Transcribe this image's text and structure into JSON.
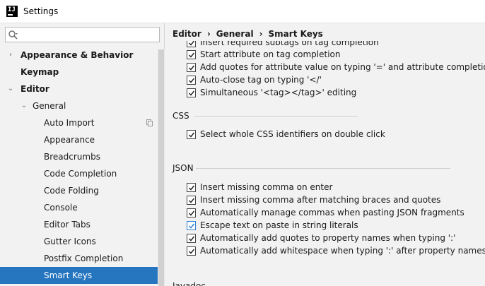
{
  "window": {
    "title": "Settings"
  },
  "search": {
    "placeholder": "",
    "value": ""
  },
  "sidebar": {
    "items": [
      {
        "label": "Appearance & Behavior"
      },
      {
        "label": "Keymap"
      },
      {
        "label": "Editor"
      },
      {
        "label": "General"
      },
      {
        "label": "Auto Import"
      },
      {
        "label": "Appearance"
      },
      {
        "label": "Breadcrumbs"
      },
      {
        "label": "Code Completion"
      },
      {
        "label": "Code Folding"
      },
      {
        "label": "Console"
      },
      {
        "label": "Editor Tabs"
      },
      {
        "label": "Gutter Icons"
      },
      {
        "label": "Postfix Completion"
      },
      {
        "label": "Smart Keys"
      }
    ],
    "selected": "Smart Keys"
  },
  "breadcrumb": {
    "part1": "Editor",
    "part2": "General",
    "part3": "Smart Keys",
    "separator": "›"
  },
  "options": {
    "xml": [
      {
        "label": "Insert required subtags on tag completion",
        "checked": true
      },
      {
        "label": "Start attribute on tag completion",
        "checked": true
      },
      {
        "label": "Add quotes for attribute value on typing '=' and attribute completion",
        "checked": true
      },
      {
        "label": "Auto-close tag on typing '</'",
        "checked": true
      },
      {
        "label": "Simultaneous '<tag></tag>' editing",
        "checked": true
      }
    ],
    "css_title": "CSS",
    "css": [
      {
        "label": "Select whole CSS identifiers on double click",
        "checked": true
      }
    ],
    "json_title": "JSON",
    "json": [
      {
        "label": "Insert missing comma on enter",
        "checked": true
      },
      {
        "label": "Insert missing comma after matching braces and quotes",
        "checked": true
      },
      {
        "label": "Automatically manage commas when pasting JSON fragments",
        "checked": true
      },
      {
        "label": "Escape text on paste in string literals",
        "checked": true
      },
      {
        "label": "Automatically add quotes to property names when typing ':'",
        "checked": true
      },
      {
        "label": "Automatically add whitespace when typing ':' after property namess",
        "checked": true
      }
    ],
    "javadoc_title": "Javadoc"
  },
  "colors": {
    "selection": "#2675bf",
    "checkbox_accent": "#2f7fd6"
  }
}
